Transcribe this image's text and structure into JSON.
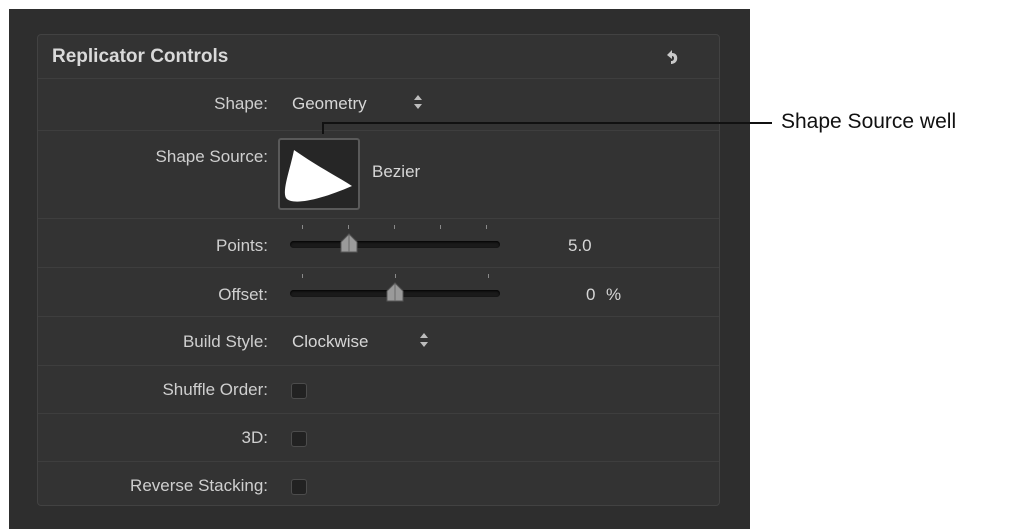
{
  "panel": {
    "title": "Replicator Controls",
    "reset_icon": "reset-arrow-icon"
  },
  "rows": {
    "shape": {
      "label": "Shape:",
      "value": "Geometry"
    },
    "shape_source": {
      "label": "Shape Source:",
      "value": "Bezier"
    },
    "points": {
      "label": "Points:",
      "value": "5.0",
      "slider_fraction": 0.28
    },
    "offset": {
      "label": "Offset:",
      "value": "0",
      "unit": "%",
      "slider_fraction": 0.5
    },
    "build_style": {
      "label": "Build Style:",
      "value": "Clockwise"
    },
    "shuffle_order": {
      "label": "Shuffle Order:",
      "checked": false
    },
    "three_d": {
      "label": "3D:",
      "checked": false
    },
    "reverse_stacking": {
      "label": "Reverse Stacking:",
      "checked": false
    }
  },
  "callout": {
    "text": "Shape Source well"
  },
  "colors": {
    "panel_bg": "#333333",
    "frame_bg": "#2e2e2e",
    "text": "#cfcfcf"
  }
}
